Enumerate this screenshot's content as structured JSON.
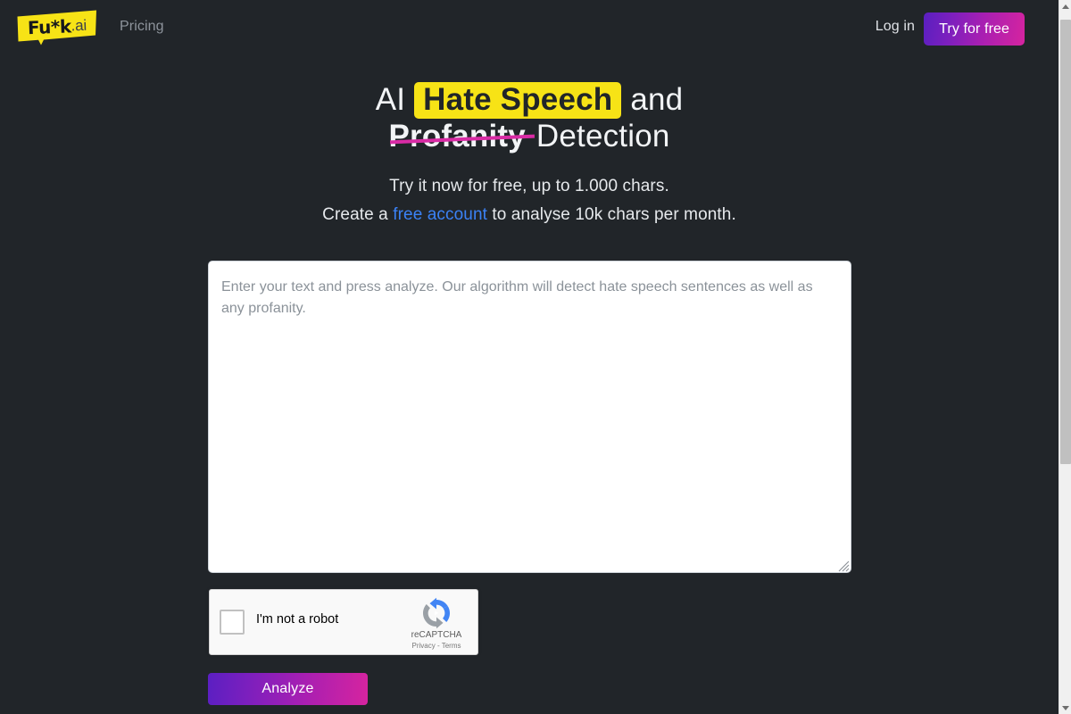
{
  "theme": {
    "background": "#212529",
    "accent_gradient_from": "#5b1fc2",
    "accent_gradient_to": "#d6249f",
    "highlight_yellow": "#f7e316",
    "strike_magenta": "#d92ba5",
    "link_blue": "#3b82f6"
  },
  "nav": {
    "logo": {
      "name": "fuk-ai-logo",
      "main_text": "Fu*k",
      "suffix_text": ".ai"
    },
    "pricing_label": "Pricing",
    "login_label": "Log in",
    "try_free_label": "Try for free"
  },
  "hero": {
    "headline": {
      "part1": "AI ",
      "highlight": "Hate Speech",
      "part2": " and",
      "strike": "Profanity",
      "part3": " Detection"
    },
    "sub_line1": "Try it now for free, up to 1.000 chars.",
    "sub_line2_before": "Create a ",
    "sub_line2_link": "free account",
    "sub_line2_after": " to analyse 10k chars per month."
  },
  "form": {
    "textarea": {
      "placeholder": "Enter your text and press analyze. Our algorithm will detect hate speech sentences as well as any profanity.",
      "value": ""
    },
    "recaptcha": {
      "label": "I'm not a robot",
      "brand": "reCAPTCHA",
      "legal": "Privacy - Terms",
      "checked": false
    },
    "analyze_label": "Analyze"
  },
  "scrollbar": {
    "up_arrow": "scroll-up",
    "down_arrow": "scroll-down",
    "thumb": "scroll-thumb"
  }
}
